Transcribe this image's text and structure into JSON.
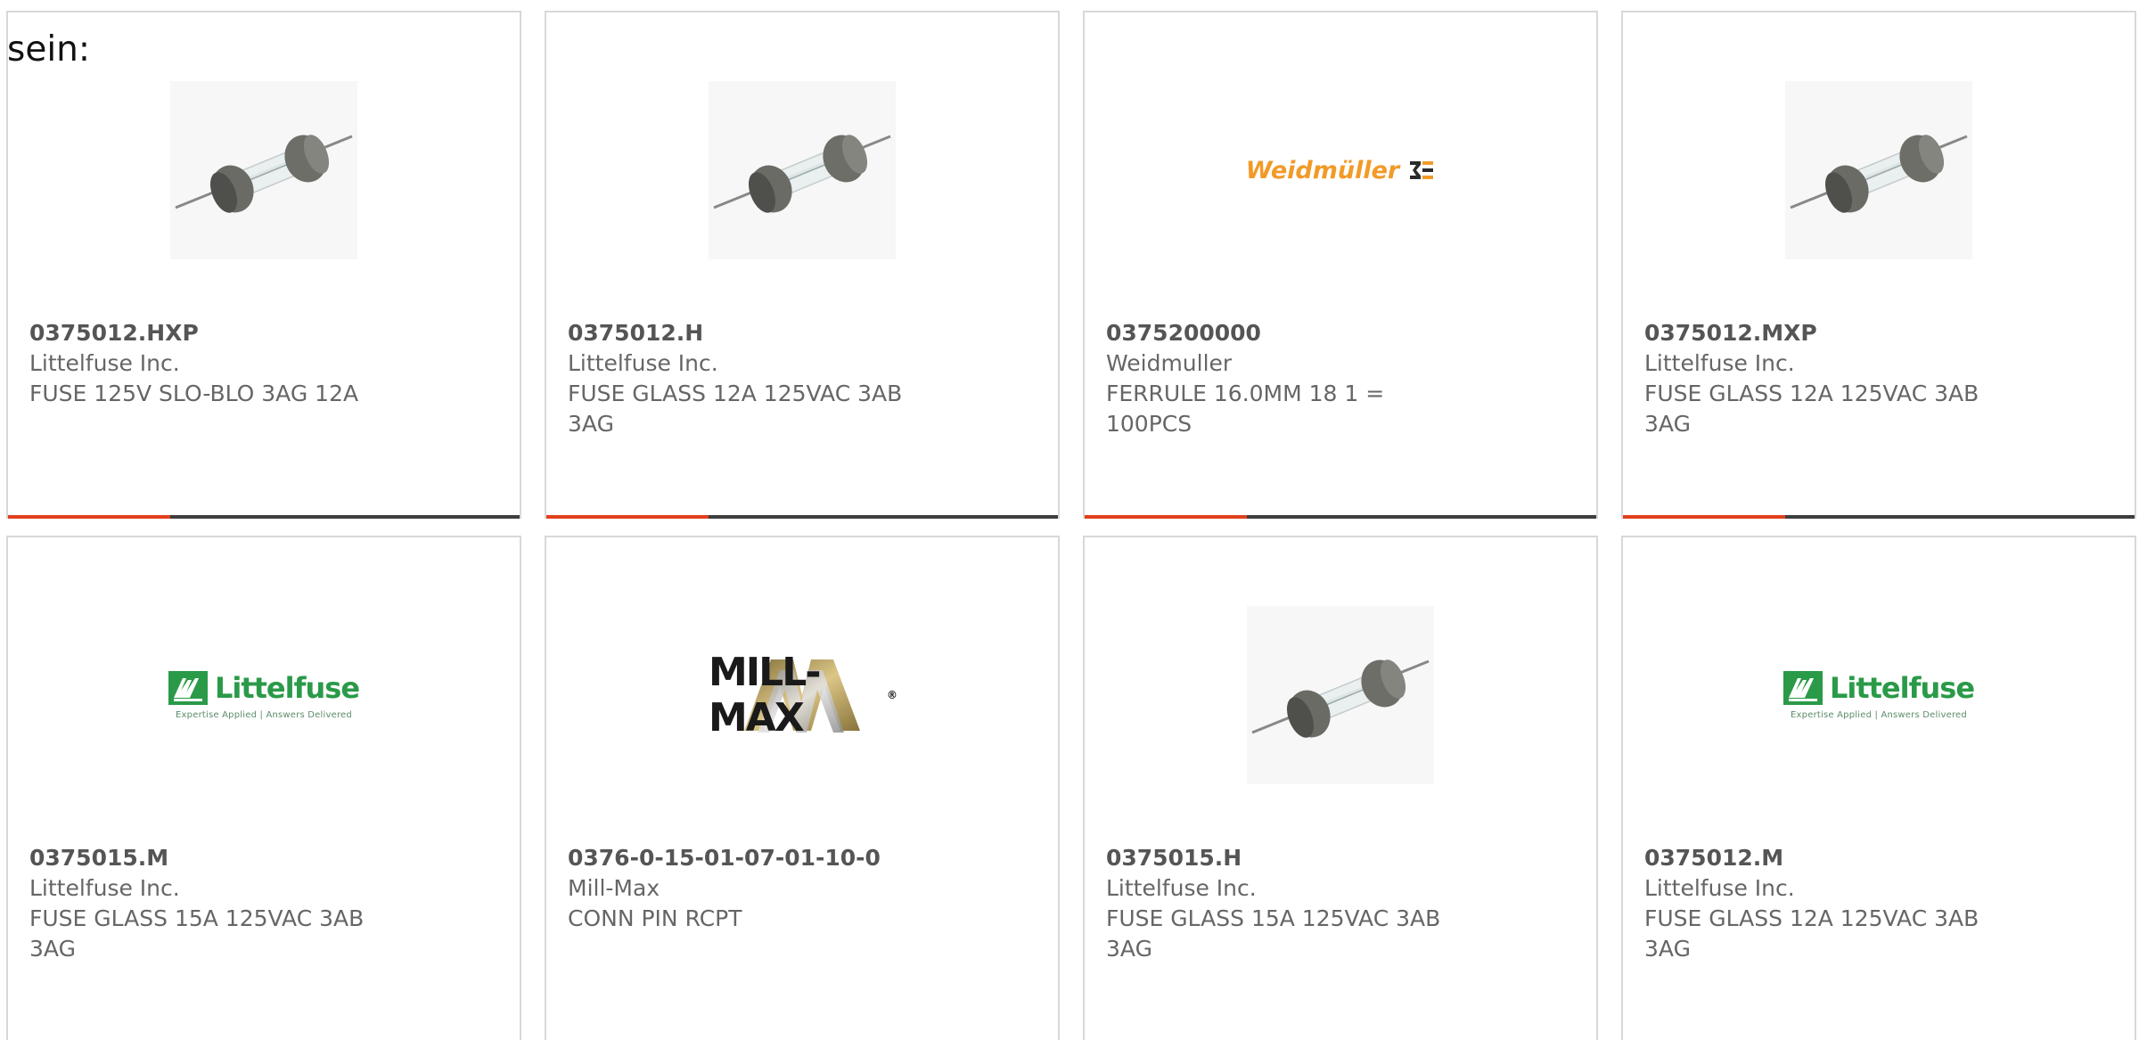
{
  "intro": {
    "text": "sein:"
  },
  "products": [
    {
      "part_number": "0375012.HXP",
      "manufacturer": "Littelfuse Inc.",
      "description": [
        "FUSE 125V SLO-BLO 3AG 12A"
      ],
      "image": "fuse-image"
    },
    {
      "part_number": "0375012.H",
      "manufacturer": "Littelfuse Inc.",
      "description": [
        "FUSE GLASS 12A 125VAC 3AB",
        "3AG"
      ],
      "image": "fuse-image"
    },
    {
      "part_number": "0375200000",
      "manufacturer": "Weidmuller",
      "description": [
        "FERRULE 16.0MM 18 1 = 100PCS"
      ],
      "image": "weidmuller-logo",
      "logo_text": "Weidmüller"
    },
    {
      "part_number": "0375012.MXP",
      "manufacturer": "Littelfuse Inc.",
      "description": [
        "FUSE GLASS 12A 125VAC 3AB",
        "3AG"
      ],
      "image": "fuse-image"
    },
    {
      "part_number": "0375015.M",
      "manufacturer": "Littelfuse Inc.",
      "description": [
        "FUSE GLASS 15A 125VAC 3AB",
        "3AG"
      ],
      "image": "littelfuse-logo",
      "logo_text": "Littelfuse",
      "logo_tagline": "Expertise Applied | Answers Delivered"
    },
    {
      "part_number": "0376-0-15-01-07-01-10-0",
      "manufacturer": "Mill-Max",
      "description": [
        "CONN PIN RCPT"
      ],
      "image": "millmax-logo",
      "logo_text": "MILL-MAX"
    },
    {
      "part_number": "0375015.H",
      "manufacturer": "Littelfuse Inc.",
      "description": [
        "FUSE GLASS 15A 125VAC 3AB",
        "3AG"
      ],
      "image": "fuse-image"
    },
    {
      "part_number": "0375012.M",
      "manufacturer": "Littelfuse Inc.",
      "description": [
        "FUSE GLASS 12A 125VAC 3AB",
        "3AG"
      ],
      "image": "littelfuse-logo",
      "logo_text": "Littelfuse",
      "logo_tagline": "Expertise Applied | Answers Delivered"
    }
  ],
  "colors": {
    "accent_bar": "#e0401c",
    "dark_bar": "#3e3e3e",
    "littelfuse_green": "#2a9a48",
    "weidmuller_orange": "#f29a28",
    "text_gray": "#666666"
  }
}
